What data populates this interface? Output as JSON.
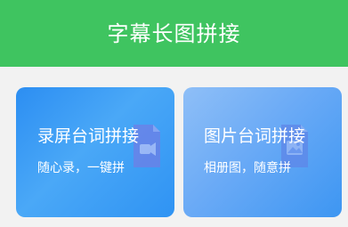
{
  "header": {
    "title": "字幕长图拼接"
  },
  "cards": [
    {
      "title": "录屏台词拼接",
      "subtitle": "随心录，一键拼",
      "icon": "video-document-icon"
    },
    {
      "title": "图片台词拼接",
      "subtitle": "相册图，随意拼",
      "icon": "image-document-icon"
    }
  ],
  "colors": {
    "header_green": "#3fc460",
    "card_blue": "#2f93f3",
    "card_light_blue": "#8fbff7",
    "background": "#f2f2f2"
  }
}
